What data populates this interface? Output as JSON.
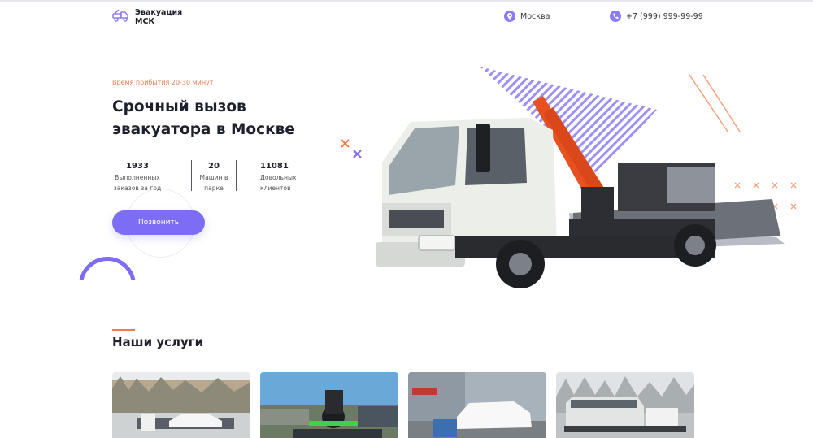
{
  "header": {
    "logo_line1": "Эвакуация",
    "logo_line2": "МСК",
    "location": "Москва",
    "phone": "+7 (999) 999-99-99"
  },
  "hero": {
    "eyebrow": "Время прибытия 20-30 минут",
    "title_line1": "Срочный вызов",
    "title_line2": "эвакуатора в Москве",
    "stats": [
      {
        "value": "1933",
        "label_line1": "Выполненных",
        "label_line2": "заказов за год"
      },
      {
        "value": "20",
        "label_line1": "Машин в",
        "label_line2": "парке"
      },
      {
        "value": "11081",
        "label_line1": "Довольных",
        "label_line2": "клиентов"
      }
    ],
    "call_button": "Позвонить"
  },
  "services": {
    "title": "Наши услуги",
    "cards": [
      {
        "icon": "tow-truck-sedan-image"
      },
      {
        "icon": "motorcycle-transport-image"
      },
      {
        "icon": "suv-on-tow-truck-image"
      },
      {
        "icon": "minibus-on-tow-truck-image"
      }
    ]
  },
  "colors": {
    "accent": "#7d6cf4",
    "eyebrow": "#f07b4f",
    "text": "#1f1f2e"
  }
}
